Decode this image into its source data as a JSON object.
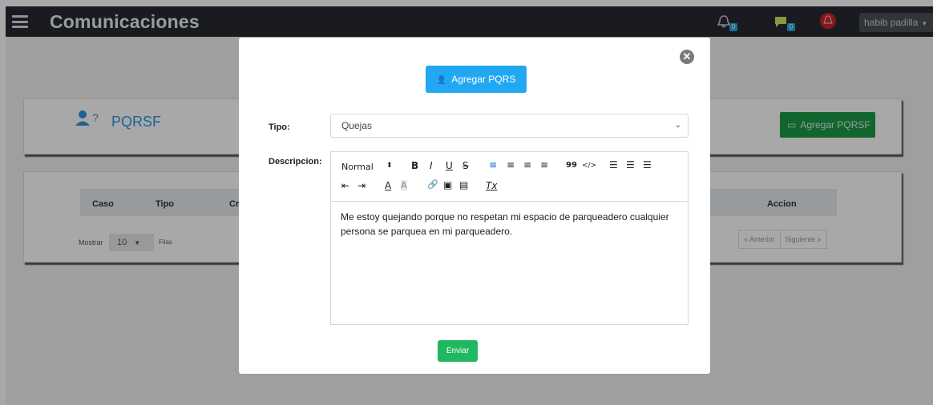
{
  "app": {
    "title": "Comunicaciones",
    "notifications_count": "0",
    "messages_count": "0",
    "user_name": "habib padilla"
  },
  "page": {
    "section_title": "PQRSF",
    "add_button_label": "Agregar PQRSF",
    "table": {
      "columns": [
        "Caso",
        "Tipo",
        "Cr",
        "Accion"
      ],
      "show_label": "Mostrar",
      "show_value": "10",
      "rows_label": "Filas",
      "prev_label": "« Anterior",
      "next_label": "Siguiente »"
    }
  },
  "modal": {
    "header_button_label": "Agregar PQRS",
    "tipo_label": "Tipo:",
    "tipo_value": "Quejas",
    "descripcion_label": "Descripcion:",
    "toolbar": {
      "header_format": "Normal",
      "header_caret": "⬍",
      "bold": "B",
      "italic": "I",
      "underline": "U",
      "strike": "S",
      "align_left": "≡",
      "align_center": "≡",
      "align_right": "≡",
      "align_justify": "≡",
      "blockquote": "99",
      "code": "</>",
      "ordered_list": "☰",
      "bullet_list": "☰",
      "check_list": "☰",
      "outdent": "⇤",
      "indent": "⇥",
      "text_color": "A",
      "background_color": "A",
      "link": "🔗",
      "image": "▣",
      "video": "▤",
      "clean": "Tx"
    },
    "description_text": "Me estoy quejando porque no respetan mi espacio de parqueadero cualquier persona se parquea en mi parqueadero.",
    "submit_label": "Enviar",
    "colors": {
      "primary": "#22a8f2",
      "success": "#22b861"
    }
  }
}
